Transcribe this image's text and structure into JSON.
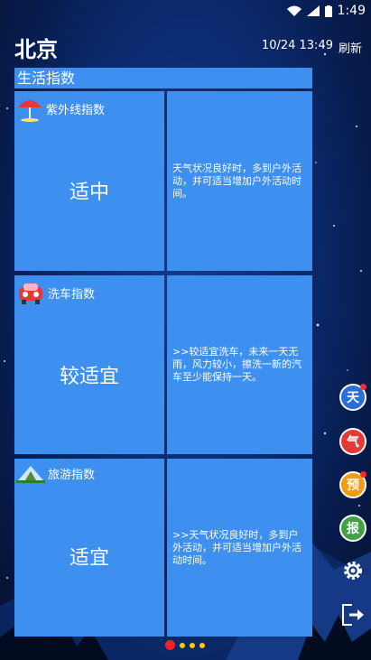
{
  "status_bar": {
    "time": "1:49"
  },
  "header": {
    "city": "北京",
    "update_time": "10/24 13:49",
    "refresh_label": "刷新"
  },
  "section": {
    "title": "生活指数"
  },
  "cards": [
    {
      "name": "紫外线指数",
      "value": "适中",
      "desc": "天气状况良好时，多到户外活动，并可适当增加户外活动时间。"
    },
    {
      "name": "洗车指数",
      "value": "较适宜",
      "desc": ">>较适宜洗车，未来一天无雨，风力较小，擦洗一新的汽车至少能保持一天。"
    },
    {
      "name": "旅游指数",
      "value": "适宜",
      "desc": ">>天气状况良好时，多到户外活动，并可适当增加户外活动时间。"
    }
  ],
  "side_buttons": [
    {
      "label": "天",
      "color": "#2a6fd6"
    },
    {
      "label": "气",
      "color": "#e53935"
    },
    {
      "label": "预",
      "color": "#f39c12"
    },
    {
      "label": "报",
      "color": "#43a047"
    }
  ],
  "colors": {
    "card": "#3d8ff0",
    "page_dot_active": "#ff1f1f",
    "page_dot": "#ffcc00"
  }
}
